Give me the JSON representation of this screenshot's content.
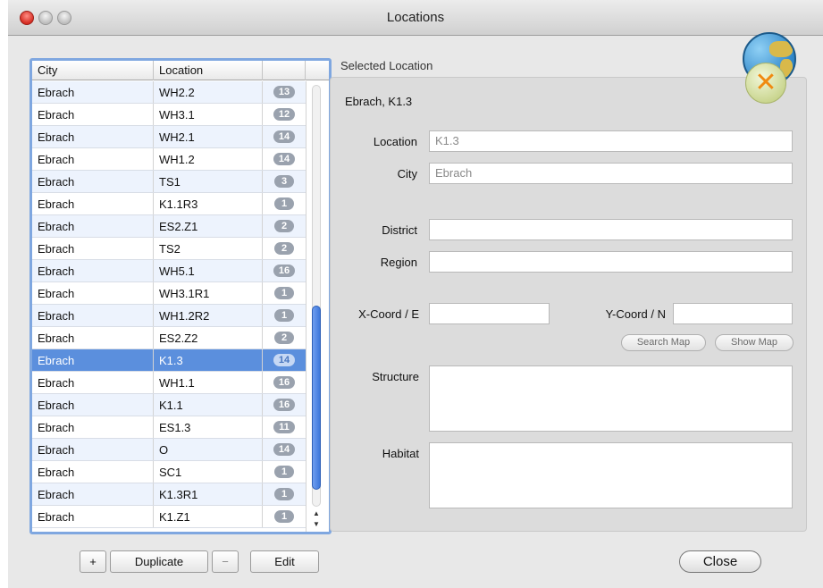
{
  "window": {
    "title": "Locations"
  },
  "table": {
    "columns": [
      "City",
      "Location",
      ""
    ],
    "rows": [
      {
        "city": "Ebrach",
        "location": "WH2.2",
        "count": "13"
      },
      {
        "city": "Ebrach",
        "location": "WH3.1",
        "count": "12"
      },
      {
        "city": "Ebrach",
        "location": "WH2.1",
        "count": "14"
      },
      {
        "city": "Ebrach",
        "location": "WH1.2",
        "count": "14"
      },
      {
        "city": "Ebrach",
        "location": "TS1",
        "count": "3"
      },
      {
        "city": "Ebrach",
        "location": "K1.1R3",
        "count": "1"
      },
      {
        "city": "Ebrach",
        "location": "ES2.Z1",
        "count": "2"
      },
      {
        "city": "Ebrach",
        "location": "TS2",
        "count": "2"
      },
      {
        "city": "Ebrach",
        "location": "WH5.1",
        "count": "16"
      },
      {
        "city": "Ebrach",
        "location": "WH3.1R1",
        "count": "1"
      },
      {
        "city": "Ebrach",
        "location": "WH1.2R2",
        "count": "1"
      },
      {
        "city": "Ebrach",
        "location": "ES2.Z2",
        "count": "2"
      },
      {
        "city": "Ebrach",
        "location": "K1.3",
        "count": "14",
        "selected": true
      },
      {
        "city": "Ebrach",
        "location": "WH1.1",
        "count": "16"
      },
      {
        "city": "Ebrach",
        "location": "K1.1",
        "count": "16"
      },
      {
        "city": "Ebrach",
        "location": "ES1.3",
        "count": "11"
      },
      {
        "city": "Ebrach",
        "location": "O",
        "count": "14"
      },
      {
        "city": "Ebrach",
        "location": "SC1",
        "count": "1"
      },
      {
        "city": "Ebrach",
        "location": "K1.3R1",
        "count": "1"
      },
      {
        "city": "Ebrach",
        "location": "K1.Z1",
        "count": "1"
      }
    ]
  },
  "buttons": {
    "add": "+",
    "duplicate": "Duplicate",
    "remove": "−",
    "edit": "Edit",
    "close": "Close"
  },
  "details": {
    "group_title": "Selected Location",
    "heading": "Ebrach, K1.3",
    "location_label": "Location",
    "location_value": "K1.3",
    "city_label": "City",
    "city_value": "Ebrach",
    "district_label": "District",
    "district_value": "",
    "region_label": "Region",
    "region_value": "",
    "xcoord_label": "X-Coord / E",
    "xcoord_value": "",
    "ycoord_label": "Y-Coord / N",
    "ycoord_value": "",
    "search_map": "Search Map",
    "show_map": "Show Map",
    "structure_label": "Structure",
    "habitat_label": "Habitat"
  },
  "icons": {
    "header_icon": "globe-delete-icon"
  }
}
